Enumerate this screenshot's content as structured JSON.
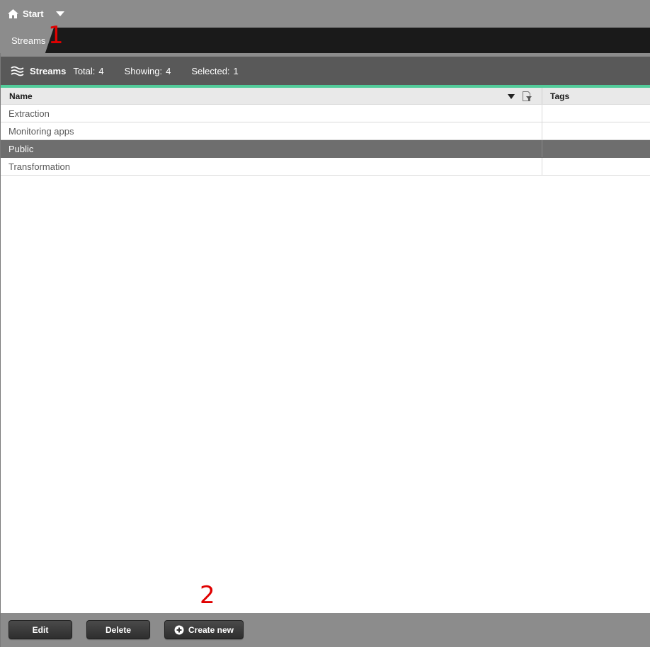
{
  "topbar": {
    "start_label": "Start"
  },
  "breadcrumb": {
    "current": "Streams"
  },
  "annotations": {
    "one": "1",
    "two": "2"
  },
  "panel": {
    "title": "Streams",
    "total_label": "Total:",
    "total_value": "4",
    "showing_label": "Showing:",
    "showing_value": "4",
    "selected_label": "Selected:",
    "selected_value": "1",
    "accent_color": "#52cc9a"
  },
  "table": {
    "columns": [
      "Name",
      "Tags"
    ],
    "rows": [
      {
        "name": "Extraction",
        "tags": ""
      },
      {
        "name": "Monitoring apps",
        "tags": ""
      },
      {
        "name": "Public",
        "tags": ""
      },
      {
        "name": "Transformation",
        "tags": ""
      }
    ],
    "selected_row": "Public"
  },
  "footer": {
    "edit_label": "Edit",
    "delete_label": "Delete",
    "create_label": "Create new"
  },
  "icons": {
    "start": "home-icon",
    "streams": "streams-icon",
    "filter": "filter-icon",
    "create": "plus-circle-icon"
  }
}
